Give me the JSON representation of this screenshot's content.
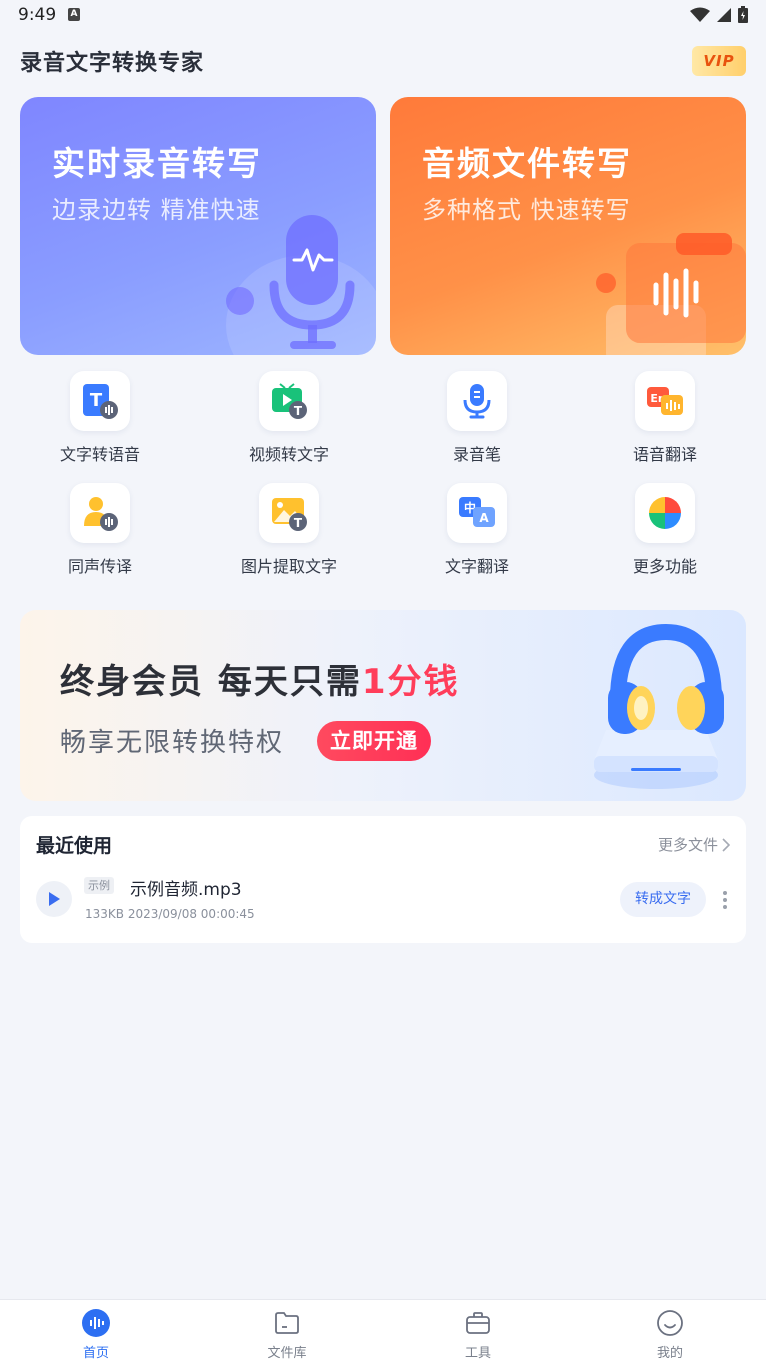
{
  "status_bar": {
    "time": "9:49",
    "a_icon": "A"
  },
  "header": {
    "title": "录音文字转换专家",
    "vip_label": "VIP"
  },
  "cards": [
    {
      "title": "实时录音转写",
      "subtitle": "边录边转 精准快速",
      "icon": "microphone-icon"
    },
    {
      "title": "音频文件转写",
      "subtitle": "多种格式 快速转写",
      "icon": "folder-audio-icon"
    }
  ],
  "features": [
    {
      "label": "文字转语音",
      "icon": "text-to-speech-icon"
    },
    {
      "label": "视频转文字",
      "icon": "video-to-text-icon"
    },
    {
      "label": "录音笔",
      "icon": "recorder-icon"
    },
    {
      "label": "语音翻译",
      "icon": "voice-translate-icon"
    },
    {
      "label": "同声传译",
      "icon": "simultaneous-interpret-icon"
    },
    {
      "label": "图片提取文字",
      "icon": "image-to-text-icon"
    },
    {
      "label": "文字翻译",
      "icon": "text-translate-icon"
    },
    {
      "label": "更多功能",
      "icon": "more-features-icon"
    }
  ],
  "promo": {
    "title_part1": "终身会员  每天只需",
    "title_highlight": "1分钱",
    "subtitle": "畅享无限转换特权",
    "cta": "立即开通"
  },
  "recent": {
    "title": "最近使用",
    "more_label": "更多文件",
    "items": [
      {
        "tag": "示例",
        "name": "示例音频.mp3",
        "meta": "133KB 2023/09/08 00:00:45",
        "action": "转成文字"
      }
    ]
  },
  "bottom_nav": [
    {
      "label": "首页",
      "active": true
    },
    {
      "label": "文件库",
      "active": false
    },
    {
      "label": "工具",
      "active": false
    },
    {
      "label": "我的",
      "active": false
    }
  ],
  "colors": {
    "accent": "#2d6ff2",
    "promo_red": "#ff3d5a",
    "card_blue": "#8a9dff",
    "card_orange": "#ff9148"
  }
}
